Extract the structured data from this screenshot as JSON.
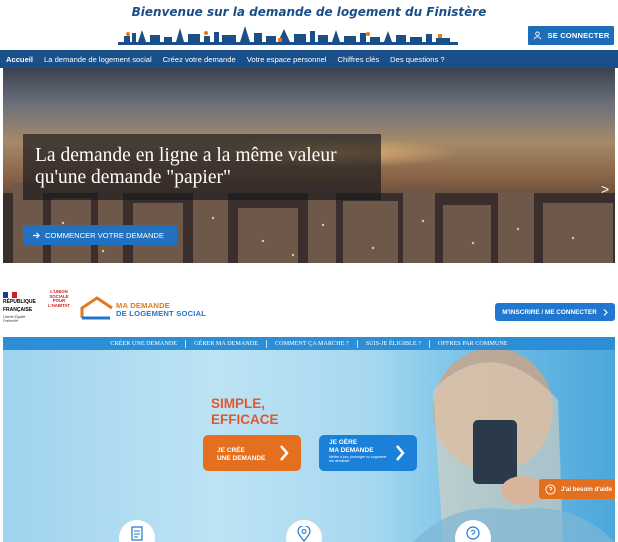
{
  "top_site": {
    "title": "Bienvenue sur la demande de logement du Finistère",
    "connect_label": "SE CONNECTER",
    "nav": [
      "Accueil",
      "La demande de logement social",
      "Créez votre demande",
      "Votre espace personnel",
      "Chiffres clés",
      "Des questions ?"
    ],
    "active_nav": "Accueil",
    "hero_caption": "La demande en ligne a la même valeur qu'une demande \"papier\"",
    "start_label": "COMMENCER VOTRE DEMANDE",
    "next_arrow": ">",
    "colors": {
      "brand_blue": "#1b4f8a",
      "button_blue": "#1e6db7"
    }
  },
  "bottom_site": {
    "gov_logo": {
      "line1": "RÉPUBLIQUE",
      "line2": "FRANÇAISE",
      "motto": "Liberté Égalité Fraternité"
    },
    "union_logo": "L'UNION SOCIALE POUR L'HABITAT",
    "brand": {
      "line1": "MA DEMANDE",
      "line2": "DE LOGEMENT SOCIAL"
    },
    "signup_label": "M'INSCRIRE / ME CONNECTER",
    "nav": [
      "CRÉER UNE DEMANDE",
      "GÉRER MA DEMANDE",
      "COMMENT ÇA MARCHE ?",
      "SUIS-JE ÉLIGIBLE ?",
      "OFFRES PAR COMMUNE"
    ],
    "slogan": {
      "line1": "SIMPLE,",
      "line2": "EFFICACE"
    },
    "create_btn": {
      "line1": "JE CRÉE",
      "line2": "UNE DEMANDE"
    },
    "manage_btn": {
      "line1": "JE GÈRE",
      "line2": "MA DEMANDE",
      "sub": "Mettre à jour, prolonger ou supprimer ma demande"
    },
    "help_label": "J'ai besoin d'aide",
    "feature_icons": [
      "document-icon",
      "location-pin-icon",
      "question-bubble-icon"
    ],
    "colors": {
      "orange": "#e4701f",
      "blue": "#1f77d0",
      "nav_blue": "#2c8fd6"
    }
  }
}
